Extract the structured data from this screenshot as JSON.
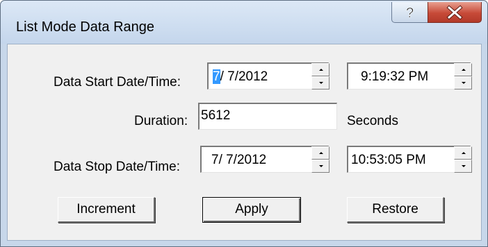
{
  "window": {
    "title": "List Mode Data Range"
  },
  "title_buttons": {
    "help": "?"
  },
  "start": {
    "label": "Data Start Date/Time:",
    "date_selected_digit": "7",
    "date_rest": "/  7/2012",
    "time": "9:19:32 PM"
  },
  "duration": {
    "label": "Duration:",
    "value": "5612",
    "unit": "Seconds"
  },
  "stop": {
    "label": "Data Stop Date/Time:",
    "date": "7/  7/2012",
    "time": "10:53:05 PM"
  },
  "buttons": {
    "increment": "Increment",
    "apply": "Apply",
    "restore": "Restore"
  },
  "colors": {
    "selection": "#3399ff",
    "close_button": "#c74a38",
    "frame": "#c7d7ea"
  }
}
